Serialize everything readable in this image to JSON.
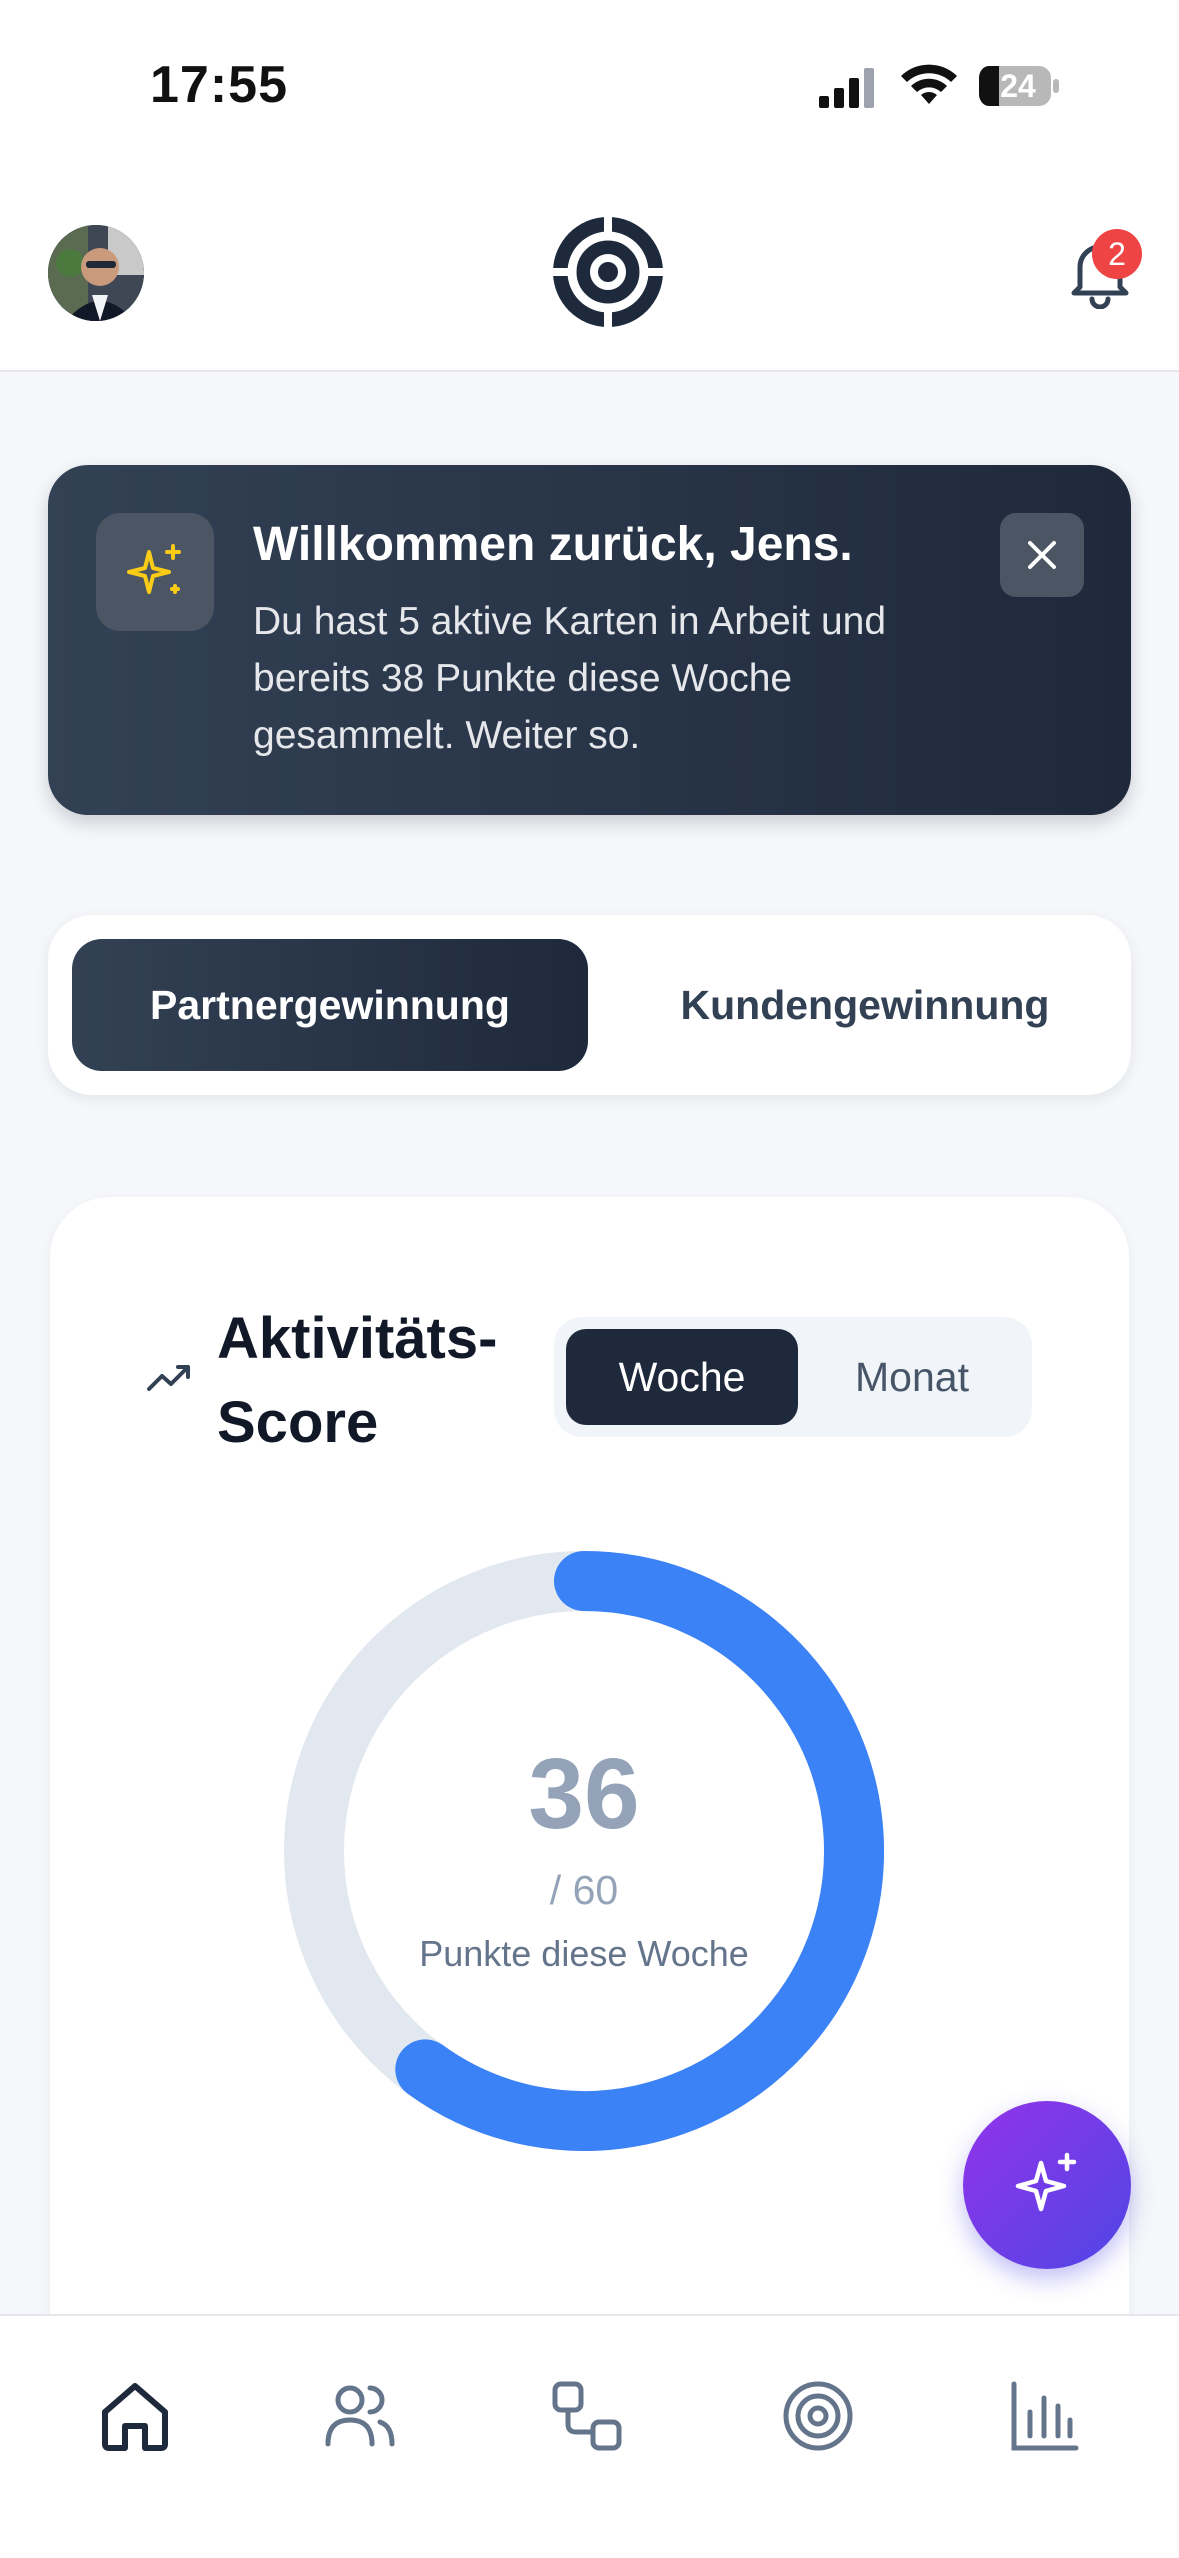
{
  "status_bar": {
    "time": "17:55",
    "battery": "24",
    "icons": [
      "signal-icon",
      "wifi-icon",
      "battery-icon"
    ]
  },
  "header": {
    "avatar_icon": "user-avatar",
    "logo_icon": "target-logo-icon",
    "notification_icon": "bell-icon",
    "notification_count": "2"
  },
  "welcome": {
    "icon": "sparkles-icon",
    "title": "Willkommen zurück, Jens.",
    "text": "Du hast 5 aktive Karten in Arbeit und bereits 38 Punkte diese Woche gesammelt. Weiter so.",
    "close_icon": "close-icon"
  },
  "segment": {
    "tabs": [
      {
        "label": "Partnergewinnung",
        "active": true
      },
      {
        "label": "Kundengewinnung",
        "active": false
      }
    ]
  },
  "score": {
    "icon": "trending-up-icon",
    "title": "Aktivitäts-Score",
    "period_tabs": [
      {
        "label": "Woche",
        "active": true
      },
      {
        "label": "Monat",
        "active": false
      }
    ],
    "value": "36",
    "max": "/ 60",
    "label": "Punkte diese Woche",
    "progress_fraction": 0.6,
    "colors": {
      "progress": "#3b82f6",
      "track": "#e2e8f0"
    }
  },
  "fab": {
    "icon": "sparkles-icon"
  },
  "bottom_nav": {
    "items": [
      {
        "icon": "home-icon",
        "active": true
      },
      {
        "icon": "users-icon",
        "active": false
      },
      {
        "icon": "cards-icon",
        "active": false
      },
      {
        "icon": "target-icon",
        "active": false
      },
      {
        "icon": "bar-chart-icon",
        "active": false
      }
    ]
  },
  "colors": {
    "dark": "#1e293b",
    "accent": "#3b82f6",
    "badge": "#ef4444",
    "fab_gradient": [
      "#9333ea",
      "#4f46e5"
    ]
  }
}
